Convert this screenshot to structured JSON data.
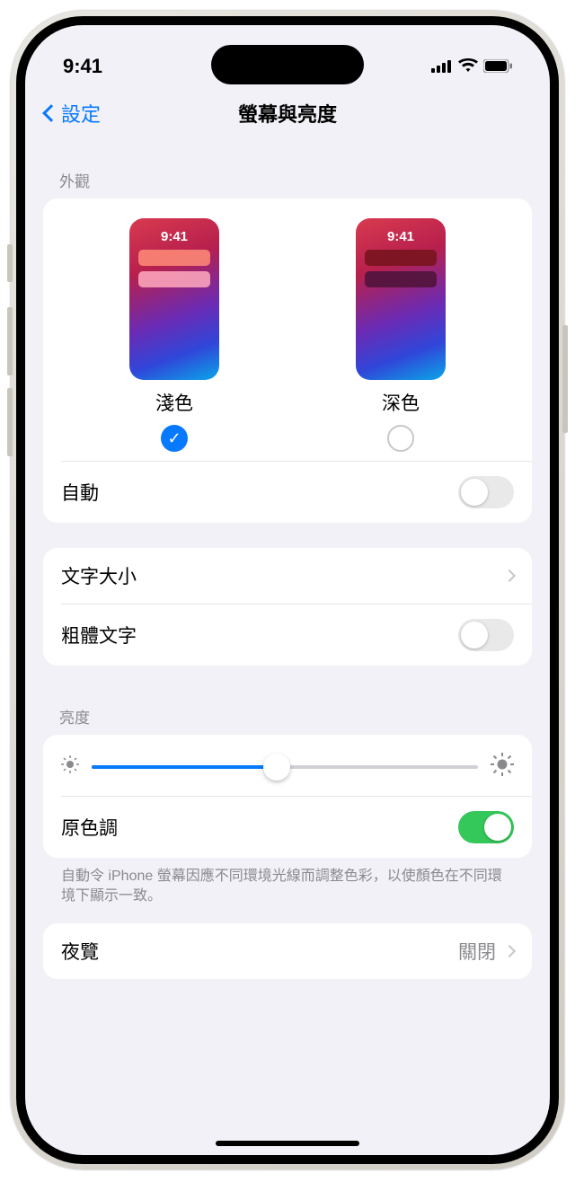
{
  "status": {
    "time": "9:41"
  },
  "nav": {
    "back_label": "設定",
    "title": "螢幕與亮度"
  },
  "appearance": {
    "section_label": "外觀",
    "preview_time": "9:41",
    "options": [
      {
        "label": "淺色",
        "checked": true
      },
      {
        "label": "深色",
        "checked": false
      }
    ],
    "auto_label": "自動",
    "auto_on": false
  },
  "text": {
    "text_size_label": "文字大小",
    "bold_text_label": "粗體文字",
    "bold_on": false
  },
  "brightness": {
    "section_label": "亮度",
    "value_percent": 48,
    "true_tone_label": "原色調",
    "true_tone_on": true,
    "footer": "自動令 iPhone 螢幕因應不同環境光線而調整色彩，以使顏色在不同環境下顯示一致。"
  },
  "night_shift": {
    "label": "夜覽",
    "value": "關閉"
  }
}
